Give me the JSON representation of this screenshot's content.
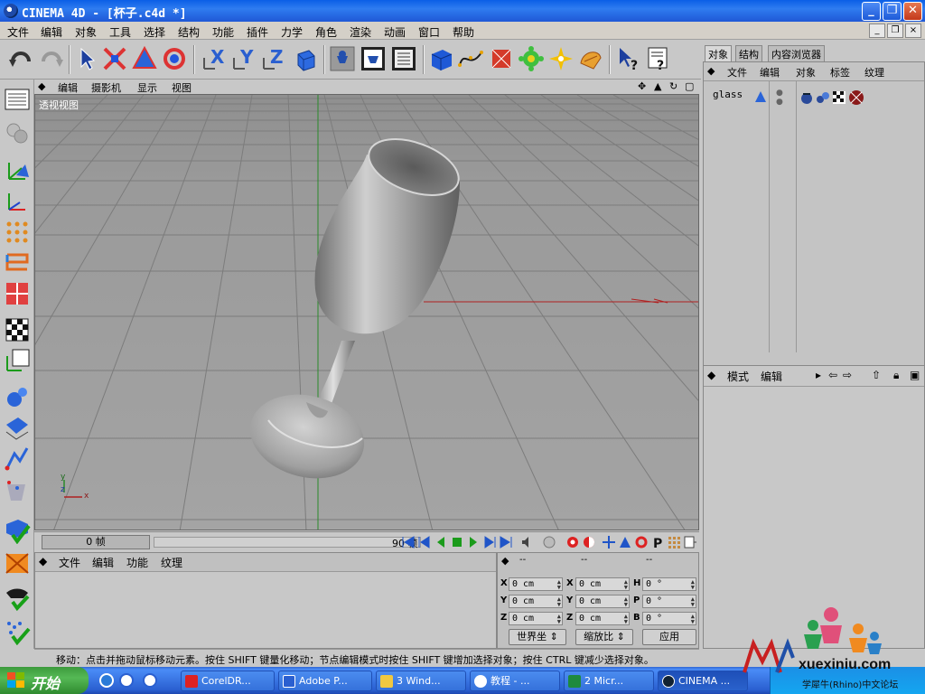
{
  "window": {
    "title": "CINEMA 4D - [杯子.c4d *]",
    "minimize": "_",
    "restore": "❐",
    "close": "✕"
  },
  "menu": {
    "items": [
      "文件",
      "编辑",
      "对象",
      "工具",
      "选择",
      "结构",
      "功能",
      "插件",
      "力学",
      "角色",
      "渲染",
      "动画",
      "窗口",
      "帮助"
    ],
    "mdi_min": "_",
    "mdi_restore": "❐",
    "mdi_close": "×"
  },
  "toolbar_icons": [
    "undo-icon",
    "redo-icon",
    "select-arrow-icon",
    "move-icon",
    "scale-icon",
    "rotate-icon",
    "x-axis-icon",
    "y-axis-icon",
    "z-axis-icon",
    "world-coords-icon",
    "render-view-icon",
    "render-picture-viewer-icon",
    "render-settings-icon",
    "cube-icon",
    "spline-icon",
    "nurbs-icon",
    "array-icon",
    "light-flare-icon",
    "deformer-icon",
    "camera-icon",
    "help-pointer-icon",
    "info-icon"
  ],
  "viewport": {
    "menu": [
      "编辑",
      "摄影机",
      "显示",
      "视图"
    ],
    "label": "透视视图",
    "axis_y": "y",
    "axis_z": "z",
    "axis_x": "x",
    "nav_icons": [
      "move-view-icon",
      "zoom-view-icon",
      "rotate-view-icon",
      "maximize-view-icon"
    ]
  },
  "timeline": {
    "current_frame": "0 帧",
    "end_frame": "90 帧"
  },
  "material_manager": {
    "menu": [
      "文件",
      "编辑",
      "功能",
      "纹理"
    ]
  },
  "coordinates": {
    "headers": [
      "--",
      "--",
      "--"
    ],
    "rows": [
      {
        "axis1": "X",
        "pos": "0 cm",
        "axis2": "X",
        "size": "0 cm",
        "axis3": "H",
        "rot": "0 °"
      },
      {
        "axis1": "Y",
        "pos": "0 cm",
        "axis2": "Y",
        "size": "0 cm",
        "axis3": "P",
        "rot": "0 °"
      },
      {
        "axis1": "Z",
        "pos": "0 cm",
        "axis2": "Z",
        "size": "0 cm",
        "axis3": "B",
        "rot": "0 °"
      }
    ],
    "mode_select": "世界坐",
    "size_select": "缩放比",
    "apply": "应用"
  },
  "object_manager": {
    "tabs": [
      "对象",
      "结构",
      "内容浏览器"
    ],
    "menu": [
      "文件",
      "编辑",
      "对象",
      "标签",
      "纹理"
    ],
    "object_name": "glass"
  },
  "attribute_manager": {
    "menu": [
      "模式",
      "编辑"
    ]
  },
  "status": {
    "text": "移动：点击并拖动鼠标移动元素。按住 SHIFT 键量化移动；节点编辑模式时按住 SHIFT 键增加选择对象；按住 CTRL 键减少选择对象。"
  },
  "taskbar": {
    "start": "开始",
    "tasks": [
      "CorelDR...",
      "Adobe P...",
      "3 Wind...",
      "教程 - ...",
      "2 Micr...",
      "CINEMA ..."
    ]
  },
  "watermark": {
    "domain": "xuexiniu.com",
    "caption": "学犀牛(Rhino)中文论坛"
  }
}
